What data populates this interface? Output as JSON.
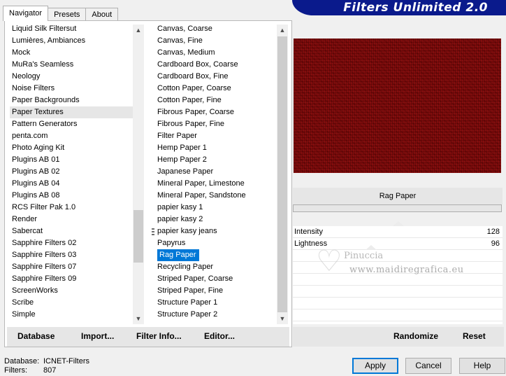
{
  "tabs": [
    {
      "label": "Navigator",
      "active": true
    },
    {
      "label": "Presets",
      "active": false
    },
    {
      "label": "About",
      "active": false
    }
  ],
  "banner": {
    "title": "Filters Unlimited 2.0",
    "color": "#0a1a8c"
  },
  "categories": {
    "items": [
      "Liquid Silk Filtersut",
      "Lumières, Ambiances",
      "Mock",
      "MuRa's Seamless",
      "Neology",
      "Noise Filters",
      "Paper Backgrounds",
      "Paper Textures",
      "Pattern Generators",
      "penta.com",
      "Photo Aging Kit",
      "Plugins AB 01",
      "Plugins AB 02",
      "Plugins AB 04",
      "Plugins AB 08",
      "RCS Filter Pak 1.0",
      "Render",
      "Sabercat",
      "Sapphire Filters 02",
      "Sapphire Filters 03",
      "Sapphire Filters 07",
      "Sapphire Filters 09",
      "ScreenWorks",
      "Scribe",
      "Simple"
    ],
    "selected": "Paper Textures"
  },
  "filters": {
    "items": [
      "Canvas, Coarse",
      "Canvas, Fine",
      "Canvas, Medium",
      "Cardboard Box, Coarse",
      "Cardboard Box, Fine",
      "Cotton Paper, Coarse",
      "Cotton Paper, Fine",
      "Fibrous Paper, Coarse",
      "Fibrous Paper, Fine",
      "Filter Paper",
      "Hemp Paper 1",
      "Hemp Paper 2",
      "Japanese Paper",
      "Mineral Paper, Limestone",
      "Mineral Paper, Sandstone",
      "papier kasy 1",
      "papier kasy 2",
      "papier kasy jeans",
      "Papyrus",
      "Rag Paper",
      "Recycling Paper",
      "Striped Paper, Coarse",
      "Striped Paper, Fine",
      "Structure Paper 1",
      "Structure Paper 2"
    ],
    "selected": "Rag Paper"
  },
  "left_buttons": {
    "database": "Database",
    "import": "Import...",
    "filter_info": "Filter Info...",
    "editor": "Editor..."
  },
  "right_buttons": {
    "randomize": "Randomize",
    "reset": "Reset"
  },
  "filter_name": "Rag Paper",
  "params": [
    {
      "label": "Intensity",
      "value": "128"
    },
    {
      "label": "Lightness",
      "value": "96"
    }
  ],
  "watermark": {
    "name": "Pinuccia",
    "url": "www.maidiregrafica.eu"
  },
  "status": {
    "database_label": "Database:",
    "database_value": "ICNET-Filters",
    "filters_label": "Filters:",
    "filters_value": "807"
  },
  "dialog": {
    "apply": "Apply",
    "cancel": "Cancel",
    "help": "Help"
  },
  "colors": {
    "preview": "#7a0a0a",
    "selection": "#0078d7"
  }
}
